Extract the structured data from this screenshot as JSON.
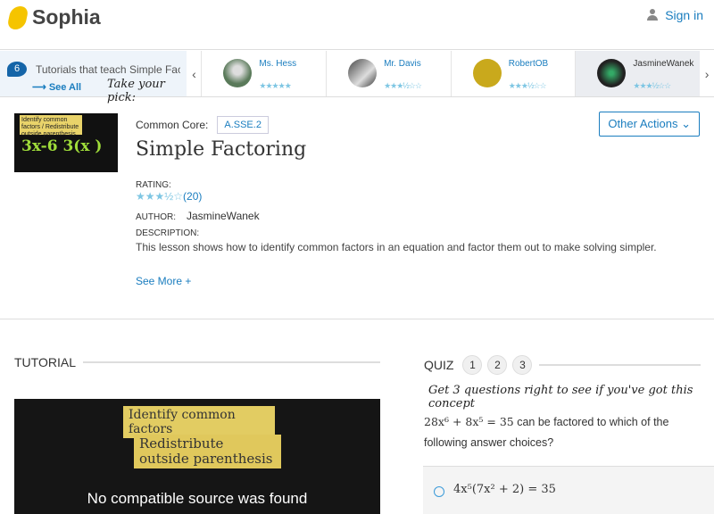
{
  "header": {
    "logo": "Sophia",
    "signin": "Sign in"
  },
  "strip": {
    "count": "6",
    "intro": "Tutorials that teach Simple Factoring",
    "see_all": "See All",
    "pick": "Take your pick:",
    "cards": [
      {
        "name": "Ms. Hess",
        "rating": 4.5,
        "stars": "★★★★★"
      },
      {
        "name": "Mr. Davis",
        "rating": 3.5,
        "stars": "★★★½☆☆"
      },
      {
        "name": "RobertOB",
        "rating": 3.5,
        "stars": "★★★½☆☆"
      },
      {
        "name": "JasmineWanek",
        "rating": 3.5,
        "stars": "★★★½☆☆"
      }
    ]
  },
  "lesson": {
    "common_core_label": "Common Core:",
    "standard": "A.SSE.2",
    "other_actions": "Other Actions",
    "title": "Simple Factoring",
    "rating_label": "RATING:",
    "stars": "★★★½☆",
    "rating_count": "(20)",
    "author_label": "AUTHOR:",
    "author": "JasmineWanek",
    "description_label": "DESCRIPTION:",
    "description": "This lesson shows how to identify common factors in an equation and factor them out to make solving simpler.",
    "see_more": "See More +",
    "thumb_text": "Identify common factors / Redistribute outside parenthesis",
    "thumb_math": "3x-6 3(x )"
  },
  "tutorial": {
    "heading": "TUTORIAL",
    "video_line1": "Identify common factors",
    "video_line2": "Redistribute outside parenthesis",
    "video_message": "No compatible source was found"
  },
  "quiz": {
    "heading": "QUIZ",
    "steps": [
      "1",
      "2",
      "3"
    ],
    "prompt": "Get 3 questions right to see if you've got this concept",
    "question_math": "28x⁶ + 8x⁵ = 35",
    "question_text": " can be factored to which of the following answer choices?",
    "answer": "4x⁵(7x² + 2) = 35"
  }
}
